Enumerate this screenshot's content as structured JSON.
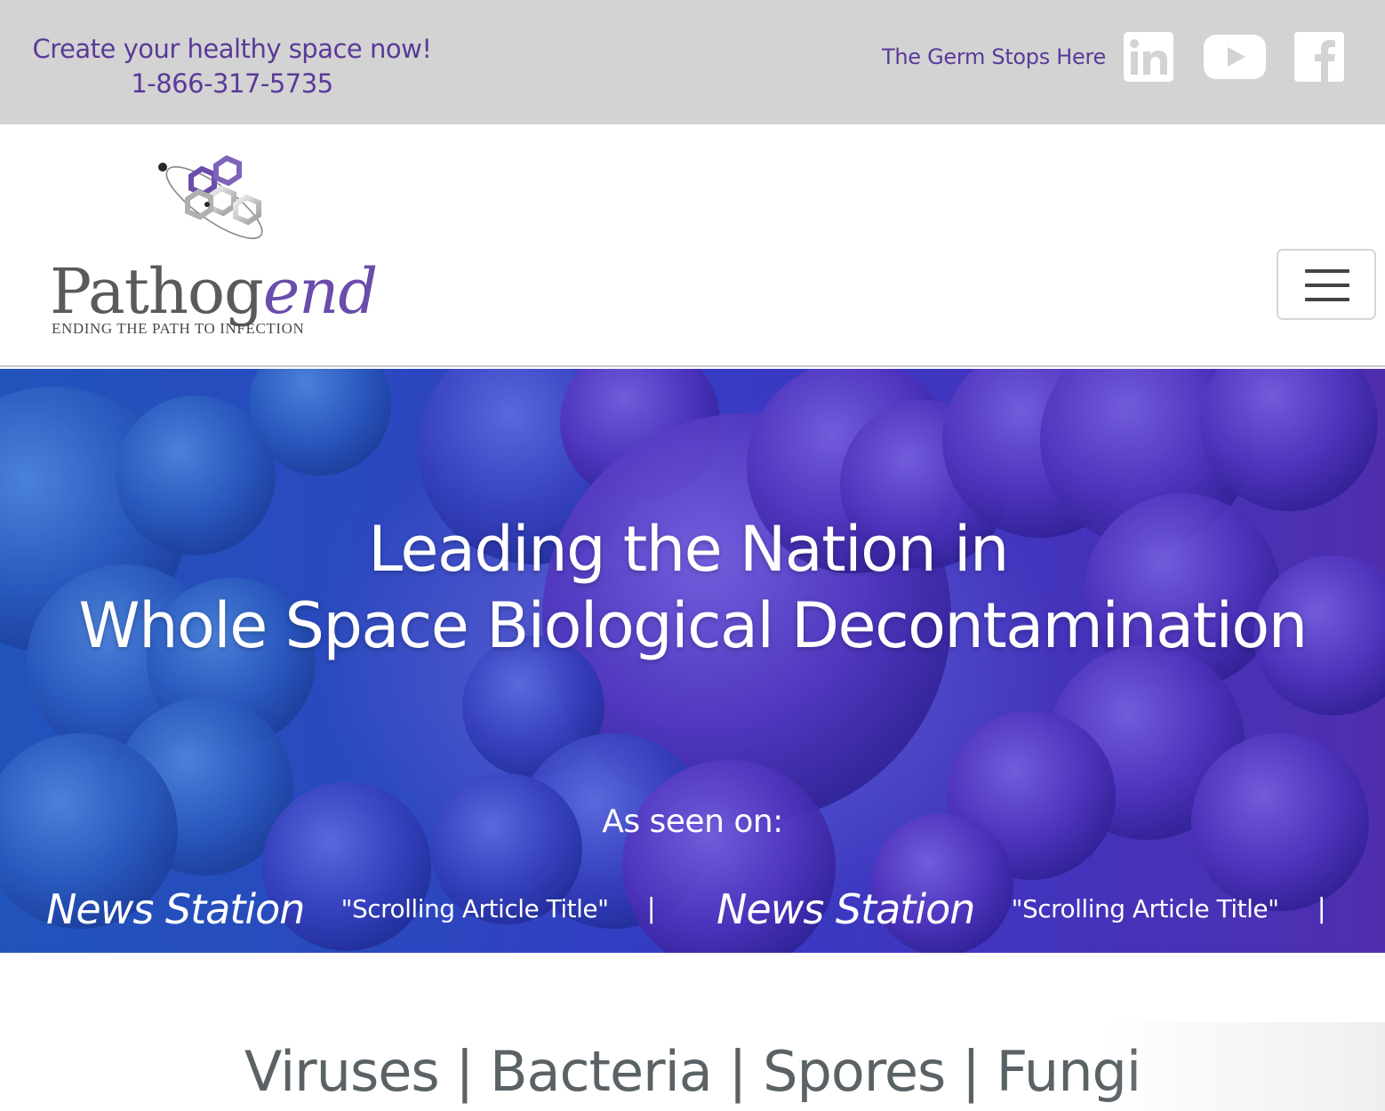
{
  "topbar": {
    "tagline": "Create your healthy space now!",
    "phone": "1-866-317-5735",
    "germ_text": "The Germ Stops Here",
    "social": [
      {
        "name": "linkedin",
        "icon": "linkedin-icon",
        "glyph": "in"
      },
      {
        "name": "youtube",
        "icon": "youtube-icon"
      },
      {
        "name": "facebook",
        "icon": "facebook-icon",
        "glyph": "f"
      }
    ],
    "text_color": "#5b3a98",
    "background": "#d3d3d3"
  },
  "header": {
    "logo": {
      "word_plain": "Pathog",
      "word_accent": "end",
      "tagline": "ENDING THE PATH TO INFECTION",
      "icon": "molecule-logo-icon"
    },
    "menu_toggle_icon": "hamburger-menu-icon"
  },
  "hero": {
    "title_line1": "Leading the Nation in",
    "title_line2": "Whole Space Biological Decontamination",
    "seen_on": "As seen on:",
    "ticker": [
      {
        "station": "News Station",
        "article": "\"Scrolling Article Title\"",
        "separator": "|"
      },
      {
        "station": "News Station",
        "article": "\"Scrolling Article Title\"",
        "separator": "|"
      }
    ]
  },
  "categories": {
    "text": "Viruses | Bacteria | Spores | Fungi"
  }
}
